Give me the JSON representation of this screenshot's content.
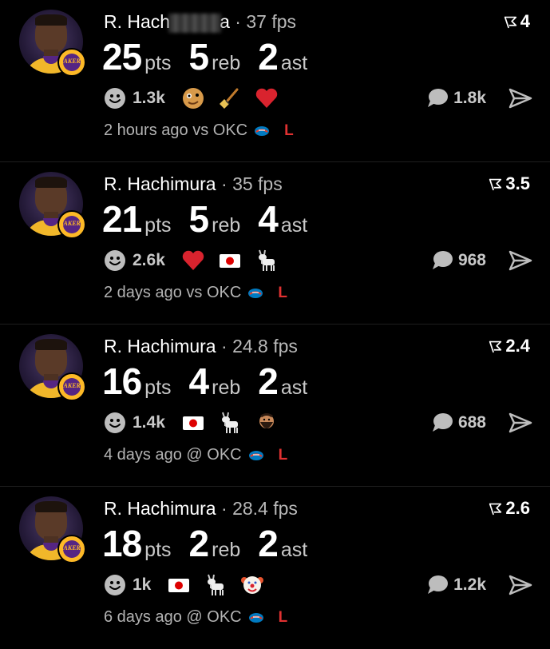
{
  "posts": [
    {
      "player": "R. Hach",
      "player_redacted": true,
      "player_suffix": "a",
      "fps": "37 fps",
      "rating": "4",
      "stats": [
        {
          "num": "25",
          "label": "pts"
        },
        {
          "num": "5",
          "label": "reb"
        },
        {
          "num": "2",
          "label": "ast"
        }
      ],
      "reaction_count": "1.3k",
      "emojis": [
        "zany-face-emoji",
        "broom-emoji",
        "red-heart-emoji"
      ],
      "comment_count": "1.8k",
      "time": "2 hours ago",
      "vs": "vs OKC",
      "result": "L"
    },
    {
      "player": "R. Hachimura",
      "player_redacted": false,
      "fps": "35 fps",
      "rating": "3.5",
      "stats": [
        {
          "num": "21",
          "label": "pts"
        },
        {
          "num": "5",
          "label": "reb"
        },
        {
          "num": "4",
          "label": "ast"
        }
      ],
      "reaction_count": "2.6k",
      "emojis": [
        "red-heart-emoji",
        "japan-flag-emoji",
        "goat-emoji"
      ],
      "comment_count": "968",
      "time": "2 days ago",
      "vs": "vs OKC",
      "result": "L"
    },
    {
      "player": "R. Hachimura",
      "player_redacted": false,
      "fps": "24.8 fps",
      "rating": "2.4",
      "stats": [
        {
          "num": "16",
          "label": "pts"
        },
        {
          "num": "4",
          "label": "reb"
        },
        {
          "num": "2",
          "label": "ast"
        }
      ],
      "reaction_count": "1.4k",
      "emojis": [
        "japan-flag-emoji",
        "goat-emoji",
        "bearded-man-emoji"
      ],
      "comment_count": "688",
      "time": "4 days ago",
      "vs": "@ OKC",
      "result": "L"
    },
    {
      "player": "R. Hachimura",
      "player_redacted": false,
      "fps": "28.4 fps",
      "rating": "2.6",
      "stats": [
        {
          "num": "18",
          "label": "pts"
        },
        {
          "num": "2",
          "label": "reb"
        },
        {
          "num": "2",
          "label": "ast"
        }
      ],
      "reaction_count": "1k",
      "emojis": [
        "japan-flag-emoji",
        "goat-emoji",
        "clown-face-emoji"
      ],
      "comment_count": "1.2k",
      "time": "6 days ago",
      "vs": "@ OKC",
      "result": "L"
    }
  ],
  "colors": {
    "background": "#000000",
    "text": "#ffffff",
    "muted": "#b3b3b3",
    "loss": "#e03131",
    "lakers_gold": "#fdb927",
    "lakers_purple": "#552583"
  },
  "icons": {
    "rating": "flag-pennant-icon",
    "reaction": "smiley-face-icon",
    "comment": "speech-bubble-icon",
    "share": "send-arrow-icon",
    "opponent": "okc-thunder-logo"
  },
  "team_badge_text": "LAKERS"
}
